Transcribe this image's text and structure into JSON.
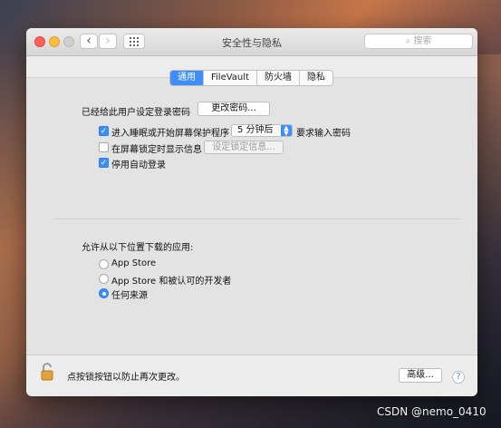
{
  "window": {
    "title": "安全性与隐私",
    "search_placeholder": "搜索",
    "nav": {
      "back": "‹",
      "forward": "›"
    }
  },
  "tabs": [
    {
      "label": "通用",
      "active": true
    },
    {
      "label": "FileVault",
      "active": false
    },
    {
      "label": "防火墙",
      "active": false
    },
    {
      "label": "隐私",
      "active": false
    }
  ],
  "general": {
    "password_set_label": "已经给此用户设定登录密码",
    "change_password_button": "更改密码...",
    "require_password": {
      "checked": true,
      "label": "进入睡眠或开始屏幕保护程序",
      "delay_value": "5 分钟后",
      "suffix": "要求输入密码"
    },
    "show_message": {
      "checked": false,
      "label": "在屏幕锁定时显示信息",
      "button": "设定锁定信息..."
    },
    "disable_autologin": {
      "checked": true,
      "label": "停用自动登录"
    }
  },
  "downloads": {
    "heading": "允许从以下位置下载的应用:",
    "options": [
      {
        "label": "App Store",
        "selected": false
      },
      {
        "label": "App Store 和被认可的开发者",
        "selected": false
      },
      {
        "label": "任何来源",
        "selected": true
      }
    ]
  },
  "footer": {
    "lock_text": "点按锁按钮以防止再次更改。",
    "advanced_button": "高级...",
    "help_label": "?"
  },
  "watermark": "CSDN @nemo_0410"
}
